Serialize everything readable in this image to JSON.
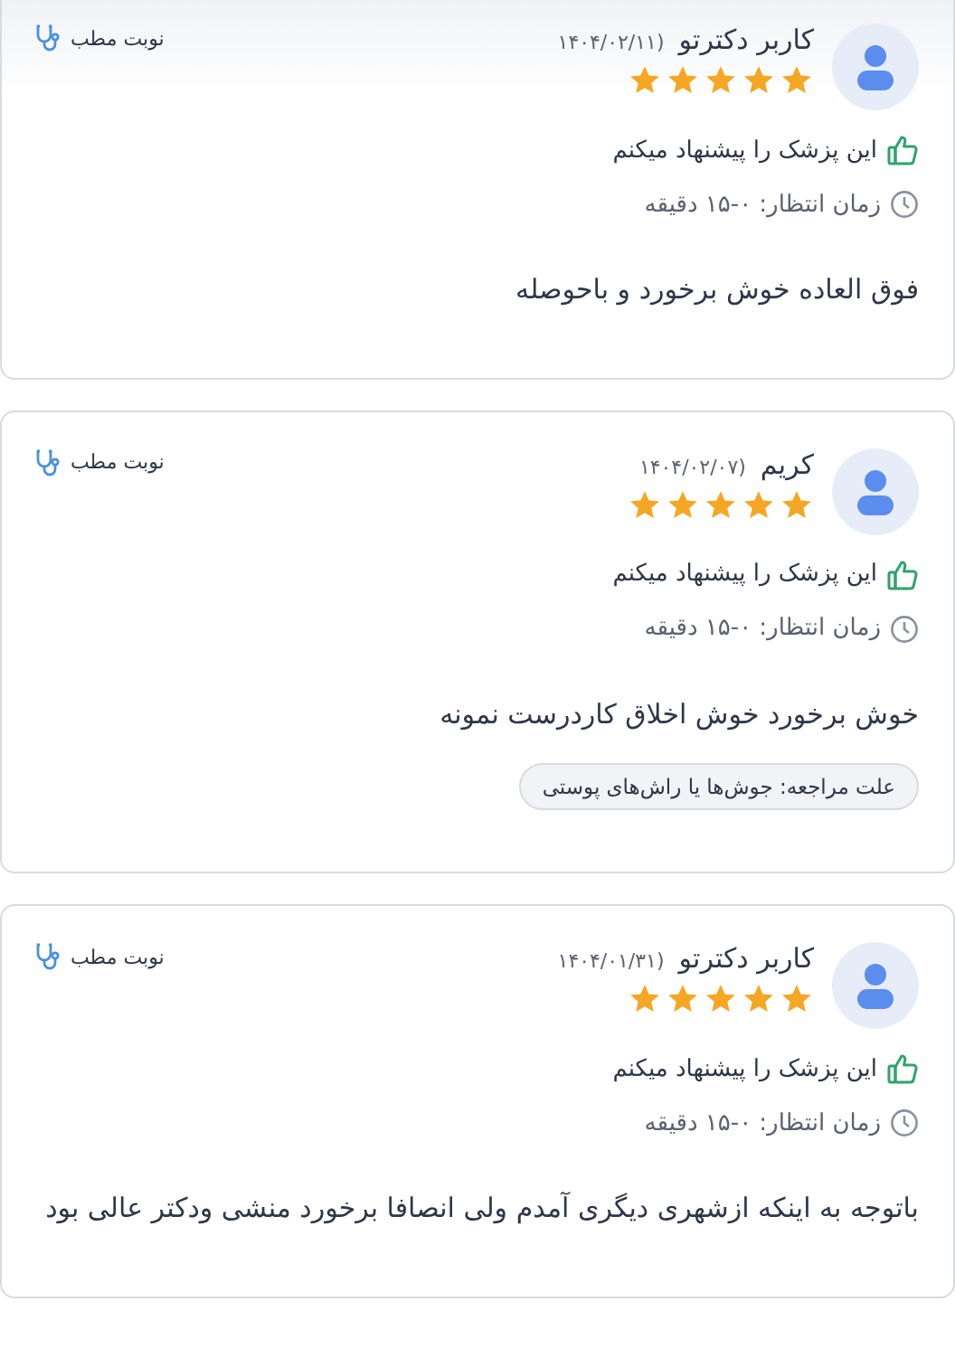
{
  "reviews": [
    {
      "user": "کاربر دکترتو",
      "date": "(۱۴۰۴/۰۲/۱۱",
      "stars": 5,
      "recommend": "این پزشک را پیشنهاد میکنم",
      "wait": "زمان انتظار: ۰-۱۵ دقیقه",
      "comment": "فوق العاده خوش برخورد و باحوصله",
      "appointment": "نوبت مطب"
    },
    {
      "user": "کریم",
      "date": "(۱۴۰۴/۰۲/۰۷",
      "stars": 5,
      "recommend": "این پزشک را پیشنهاد میکنم",
      "wait": "زمان انتظار: ۰-۱۵ دقیقه",
      "comment": "خوش برخورد خوش اخلاق کاردرست نمونه",
      "reason": "علت مراجعه: جوش‌ها یا راش‌های پوستی",
      "appointment": "نوبت مطب"
    },
    {
      "user": "کاربر دکترتو",
      "date": "(۱۴۰۴/۰۱/۳۱",
      "stars": 5,
      "recommend": "این پزشک را پیشنهاد میکنم",
      "wait": "زمان انتظار: ۰-۱۵ دقیقه",
      "comment": "باتوجه به اینکه ازشهری دیگری آمدم ولی انصافا برخورد منشی ودکتر عالی بود",
      "appointment": "نوبت مطب"
    }
  ]
}
